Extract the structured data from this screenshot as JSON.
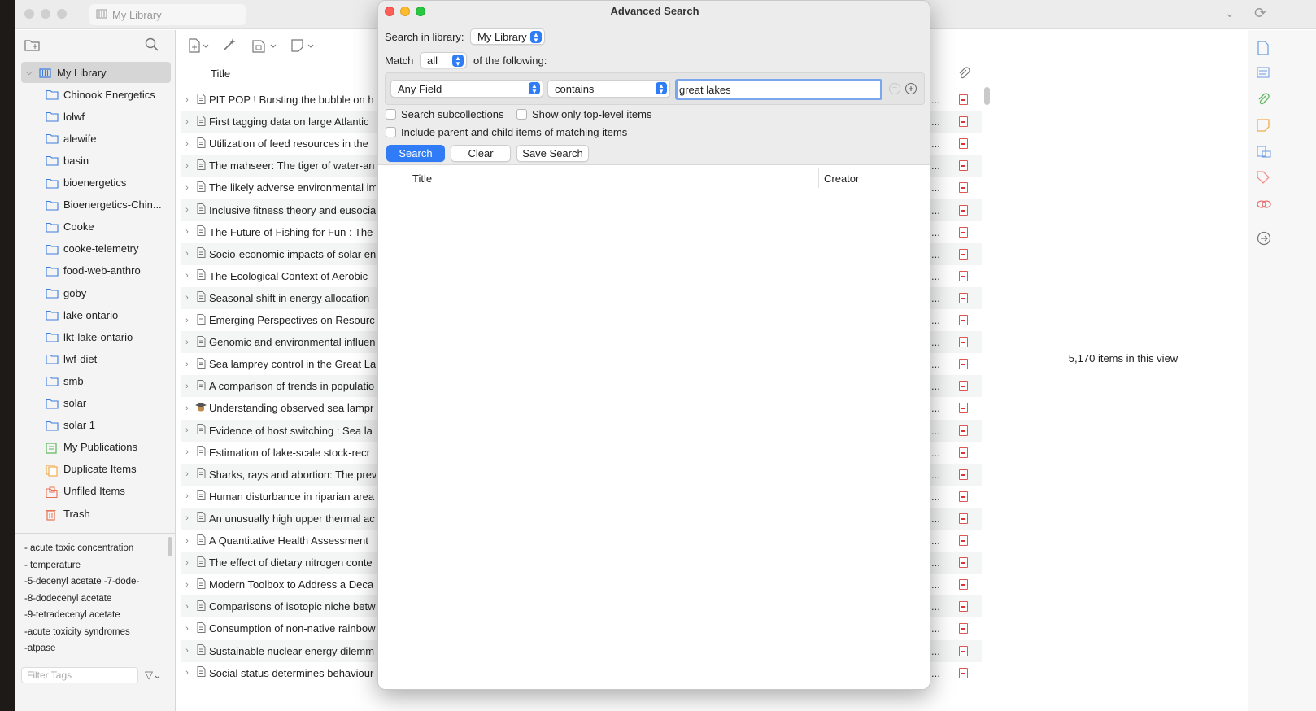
{
  "window": {
    "tab_title": "My Library"
  },
  "sidebar": {
    "collections": [
      {
        "label": "My Library",
        "icon": "library-icon",
        "selected": true
      },
      {
        "label": "Chinook Energetics",
        "icon": "folder-icon"
      },
      {
        "label": "lolwf",
        "icon": "folder-icon"
      },
      {
        "label": "alewife",
        "icon": "folder-icon"
      },
      {
        "label": "basin",
        "icon": "folder-icon"
      },
      {
        "label": "bioenergetics",
        "icon": "folder-icon"
      },
      {
        "label": "Bioenergetics-Chin...",
        "icon": "folder-icon"
      },
      {
        "label": "Cooke",
        "icon": "folder-icon"
      },
      {
        "label": "cooke-telemetry",
        "icon": "folder-icon"
      },
      {
        "label": "food-web-anthro",
        "icon": "folder-icon"
      },
      {
        "label": "goby",
        "icon": "folder-icon"
      },
      {
        "label": "lake ontario",
        "icon": "folder-icon"
      },
      {
        "label": "lkt-lake-ontario",
        "icon": "folder-icon"
      },
      {
        "label": "lwf-diet",
        "icon": "folder-icon"
      },
      {
        "label": "smb",
        "icon": "folder-icon"
      },
      {
        "label": "solar",
        "icon": "folder-icon"
      },
      {
        "label": "solar 1",
        "icon": "folder-icon"
      },
      {
        "label": "My Publications",
        "icon": "publications-icon"
      },
      {
        "label": "Duplicate Items",
        "icon": "duplicate-icon"
      },
      {
        "label": "Unfiled Items",
        "icon": "unfiled-icon"
      },
      {
        "label": "Trash",
        "icon": "trash-icon"
      }
    ],
    "tags": [
      "- acute toxic concentration",
      "- temperature",
      "-5-decenyl acetate   -7-dode-",
      "-8-dodecenyl acetate",
      "-9-tetradecenyl acetate",
      "-acute toxicity syndromes",
      "-atpase"
    ],
    "tag_filter_placeholder": "Filter Tags"
  },
  "items": {
    "column_title": "Title",
    "rows": [
      {
        "title": "PIT POP ! Bursting the bubble on h",
        "icon": "document-icon"
      },
      {
        "title": "First tagging data on large Atlantic",
        "icon": "document-icon"
      },
      {
        "title": "Utilization of feed resources in the",
        "icon": "document-icon"
      },
      {
        "title": "The mahseer: The tiger of water-an",
        "icon": "document-icon"
      },
      {
        "title": "The likely adverse environmental im",
        "icon": "document-icon"
      },
      {
        "title": "Inclusive fitness theory and eusocia",
        "icon": "document-icon"
      },
      {
        "title": "The Future of Fishing for Fun : The",
        "icon": "document-icon"
      },
      {
        "title": "Socio-economic impacts of solar en",
        "icon": "document-icon"
      },
      {
        "title": "The Ecological Context of Aerobic",
        "icon": "document-icon"
      },
      {
        "title": "Seasonal shift in energy allocation",
        "icon": "document-icon"
      },
      {
        "title": "Emerging Perspectives on Resourc",
        "icon": "document-icon"
      },
      {
        "title": "Genomic and environmental influen",
        "icon": "document-icon"
      },
      {
        "title": "Sea lamprey control in the Great La",
        "icon": "document-icon"
      },
      {
        "title": "A comparison of trends in populatio",
        "icon": "document-icon"
      },
      {
        "title": "Understanding observed sea lampr",
        "icon": "thesis-icon"
      },
      {
        "title": "Evidence of host switching : Sea la",
        "icon": "document-icon"
      },
      {
        "title": "Estimation of lake-scale stock-recr",
        "icon": "document-icon"
      },
      {
        "title": "Sharks, rays and abortion: The prev",
        "icon": "document-icon"
      },
      {
        "title": "Human disturbance in riparian area",
        "icon": "document-icon"
      },
      {
        "title": "An unusually high upper thermal ac",
        "icon": "document-icon"
      },
      {
        "title": "A Quantitative Health Assessment",
        "icon": "document-icon"
      },
      {
        "title": "The effect of dietary nitrogen conte",
        "icon": "document-icon"
      },
      {
        "title": "Modern Toolbox to Address a Deca",
        "icon": "document-icon"
      },
      {
        "title": "Comparisons of isotopic niche betw",
        "icon": "document-icon"
      },
      {
        "title": "Consumption of non-native rainbow",
        "icon": "document-icon"
      },
      {
        "title": "Sustainable nuclear energy dilemm",
        "icon": "document-icon"
      },
      {
        "title": "Social status determines behaviour",
        "icon": "document-icon"
      }
    ],
    "truncation": "..."
  },
  "right_pane": {
    "item_count": "5,170 items in this view"
  },
  "dialog": {
    "title": "Advanced Search",
    "search_in_label": "Search in library:",
    "library_value": "My Library",
    "match_label": "Match",
    "match_value": "all",
    "of_following": "of the following:",
    "field_value": "Any Field",
    "operator_value": "contains",
    "search_text": "great lakes",
    "search_subcollections": "Search subcollections",
    "show_top_level": "Show only top-level items",
    "include_parent_child": "Include parent and child items of matching items",
    "search_btn": "Search",
    "clear_btn": "Clear",
    "save_btn": "Save Search",
    "col_title": "Title",
    "col_creator": "Creator"
  },
  "colors": {
    "accent": "#2f7cf6",
    "pdf_red": "#d33333"
  }
}
